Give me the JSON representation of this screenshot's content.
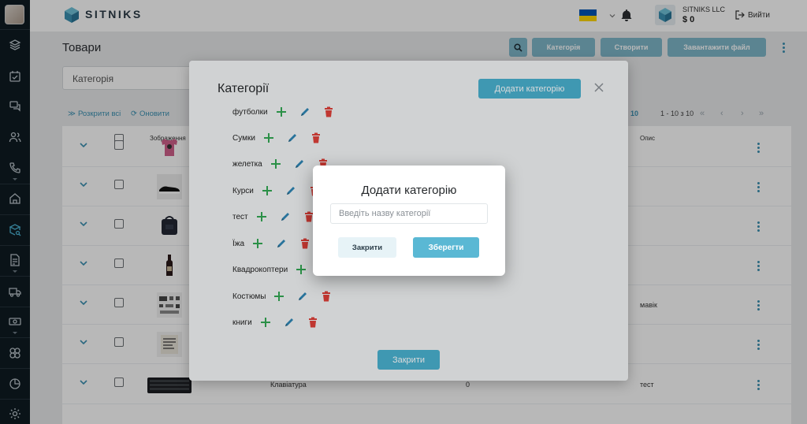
{
  "brand": {
    "name": "SITNIKS"
  },
  "header": {
    "company_name": "SITNIKS LLC",
    "balance": "$ 0",
    "logout_label": "Вийти",
    "flag": "ukraine-flag-icon"
  },
  "sidebar": {
    "icons": [
      "layers-icon",
      "calendar-check-icon",
      "chat-icon",
      "users-icon",
      "phone-icon",
      "home-icon",
      "products-icon",
      "document-icon",
      "truck-icon",
      "cash-icon",
      "integrations-icon",
      "pie-chart-icon",
      "settings-icon"
    ]
  },
  "page": {
    "title": "Товари",
    "buttons": {
      "categories": "Категорія",
      "create": "Створити",
      "upload": "Завантажити файл"
    },
    "category_filter": "Категорія",
    "expand_all": "Розкрити всі",
    "refresh": "Оновити",
    "per_page": "10",
    "range": "1 - 10 з 10"
  },
  "table": {
    "columns": {
      "image": "Зображення",
      "description": "Опис"
    },
    "rows": [
      {
        "thumb": "tshirt",
        "name": "",
        "qty": "",
        "desc": ""
      },
      {
        "thumb": "sneaker",
        "name": "",
        "qty": "",
        "desc": ""
      },
      {
        "thumb": "bag",
        "name": "",
        "qty": "",
        "desc": ""
      },
      {
        "thumb": "bottle",
        "name": "",
        "qty": "",
        "desc": ""
      },
      {
        "thumb": "drone-kit",
        "name": "",
        "qty": "",
        "desc": "мавік"
      },
      {
        "thumb": "book",
        "name": "",
        "qty": "",
        "desc": ""
      },
      {
        "thumb": "keyboard",
        "name": "Клавіатура",
        "qty": "0",
        "desc": "тест"
      }
    ]
  },
  "categories_modal": {
    "title": "Категорії",
    "add_button": "Додати категорію",
    "close_button": "Закрити",
    "items": [
      {
        "name": "футболки"
      },
      {
        "name": "Сумки"
      },
      {
        "name": "желетка"
      },
      {
        "name": "Курси"
      },
      {
        "name": "тест"
      },
      {
        "name": "Їжа"
      },
      {
        "name": "Квадрокоптери"
      },
      {
        "name": "Костюмы"
      },
      {
        "name": "книги"
      }
    ]
  },
  "add_dialog": {
    "title": "Додати категорію",
    "input_placeholder": "Введіть назву категорії",
    "input_value": "",
    "close_label": "Закрити",
    "save_label": "Зберегти"
  },
  "colors": {
    "accent": "#4ab1d0",
    "plus": "#33a853",
    "edit": "#2f86b5",
    "delete": "#e0403a"
  }
}
